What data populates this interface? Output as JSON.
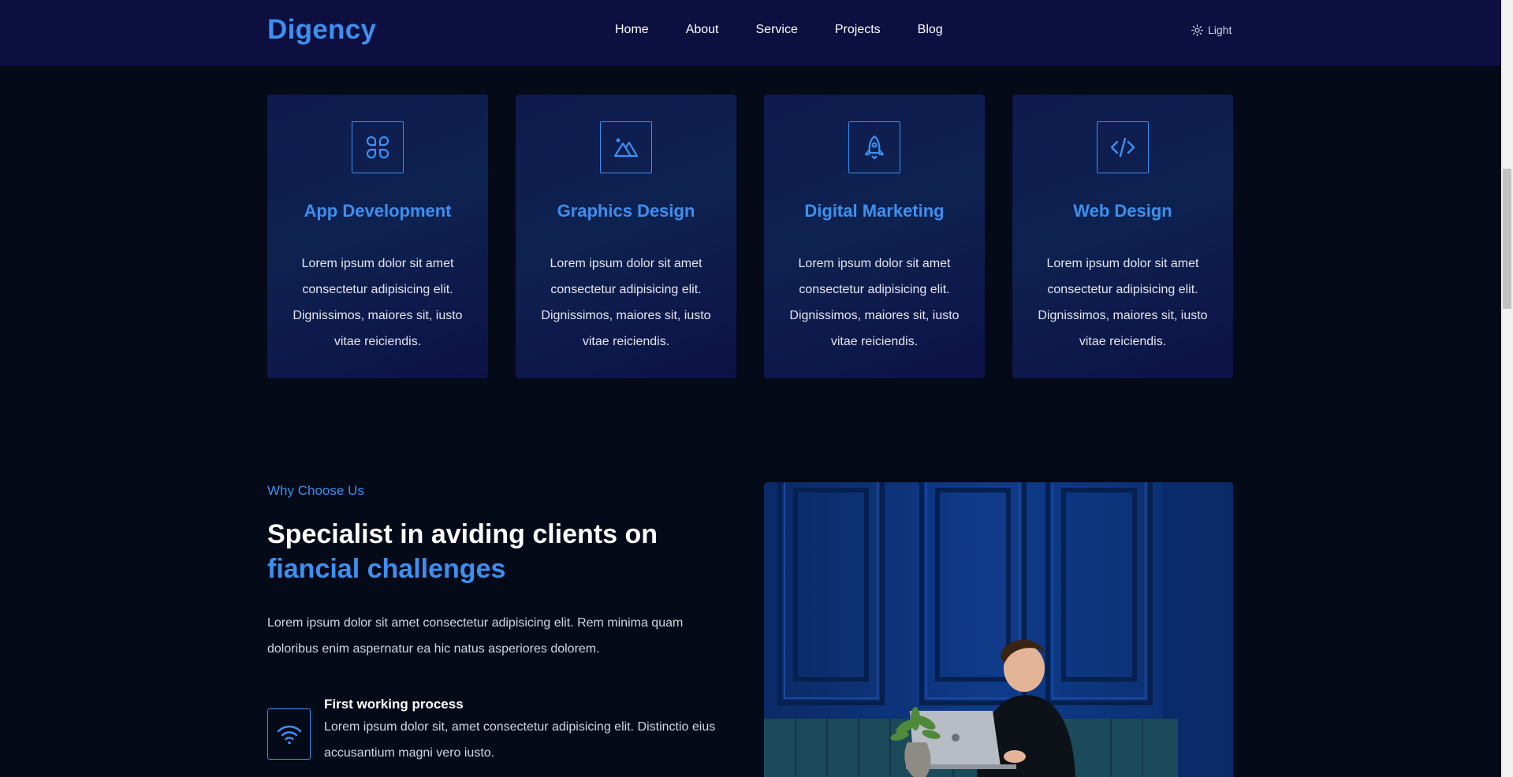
{
  "header": {
    "logo": "Digency",
    "nav": [
      "Home",
      "About",
      "Service",
      "Projects",
      "Blog"
    ],
    "theme_toggle_label": "Light",
    "theme_toggle_icon": "sun-icon"
  },
  "services": [
    {
      "icon": "app-grid-icon",
      "title": "App Development",
      "text": "Lorem ipsum dolor sit amet consectetur adipisicing elit. Dignissimos, maiores sit, iusto vitae reiciendis."
    },
    {
      "icon": "mountain-image-icon",
      "title": "Graphics Design",
      "text": "Lorem ipsum dolor sit amet consectetur adipisicing elit. Dignissimos, maiores sit, iusto vitae reiciendis."
    },
    {
      "icon": "rocket-icon",
      "title": "Digital Marketing",
      "text": "Lorem ipsum dolor sit amet consectetur adipisicing elit. Dignissimos, maiores sit, iusto vitae reiciendis."
    },
    {
      "icon": "code-icon",
      "title": "Web Design",
      "text": "Lorem ipsum dolor sit amet consectetur adipisicing elit. Dignissimos, maiores sit, iusto vitae reiciendis."
    }
  ],
  "why": {
    "eyebrow": "Why Choose Us",
    "heading_line1": "Specialist in aviding clients on",
    "heading_line2": "fiancial challenges",
    "description": "Lorem ipsum dolor sit amet consectetur adipisicing elit. Rem minima quam doloribus enim aspernatur ea hic natus asperiores dolorem.",
    "feature": {
      "icon": "wifi-icon",
      "title": "First working process",
      "text": "Lorem ipsum dolor sit, amet consectetur adipisicing elit. Distinctio eius accusantium magni vero iusto."
    }
  },
  "colors": {
    "accent": "#3d8ff0",
    "header_bg": "#0c0f3f",
    "page_bg": "#040a18",
    "card_bg": "#0f1a4e"
  }
}
